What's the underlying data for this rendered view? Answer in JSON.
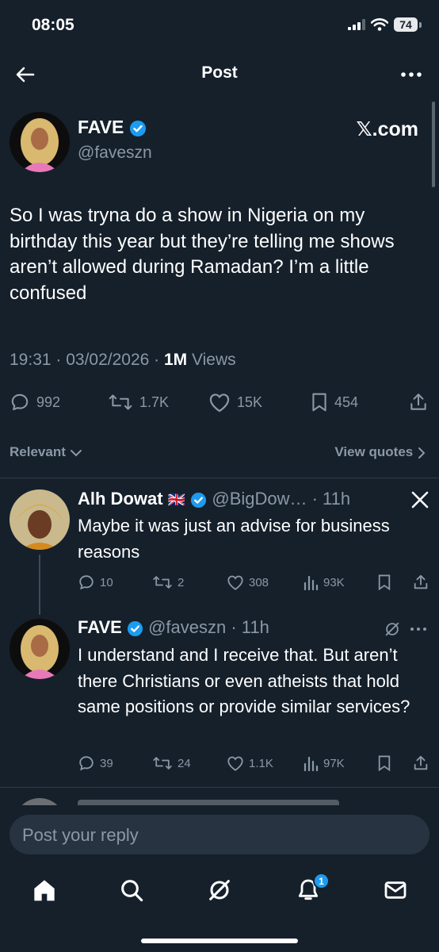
{
  "status_bar": {
    "time": "08:05",
    "battery": "74"
  },
  "nav": {
    "title": "Post"
  },
  "post": {
    "author_name": "FAVE",
    "handle": "@faveszn",
    "source": "𝕏.com",
    "text": "So I was tryna do a show in Nigeria on my birthday this year but they’re telling me shows aren’t allowed during Ramadan? I’m a little confused",
    "time_date": "19:31 · 03/02/2026 · ",
    "views_count": "1M",
    "views_label": " Views",
    "replies": "992",
    "reposts": "1.7K",
    "likes": "15K",
    "bookmarks": "454"
  },
  "filters": {
    "sort_label": "Relevant",
    "view_quotes": "View quotes"
  },
  "replies": [
    {
      "name": "Alh Dowat",
      "flag": "🇬🇧",
      "handle_time": "@BigDow… · 11h",
      "source_icon": "x-logo-icon",
      "text": "Maybe it was just an advise for business reasons",
      "replies": "10",
      "reposts": "2",
      "likes": "308",
      "views": "93K"
    },
    {
      "name": "FAVE",
      "handle_time": "@faveszn · 11h",
      "source_icon": "grok-icon",
      "text": "I understand and I receive that. But aren’t there Christians or even atheists that hold same positions or provide similar services?",
      "replies": "39",
      "reposts": "24",
      "likes": "1.1K",
      "views": "97K"
    }
  ],
  "composer": {
    "placeholder": "Post your reply"
  },
  "tab_bar": {
    "items": [
      "home-icon",
      "search-icon",
      "grok-icon",
      "notifications-icon",
      "messages-icon"
    ],
    "notifications_badge": "1"
  },
  "colors": {
    "background": "#15202b",
    "accent": "#1d9bf0",
    "muted": "#8b98a5"
  }
}
